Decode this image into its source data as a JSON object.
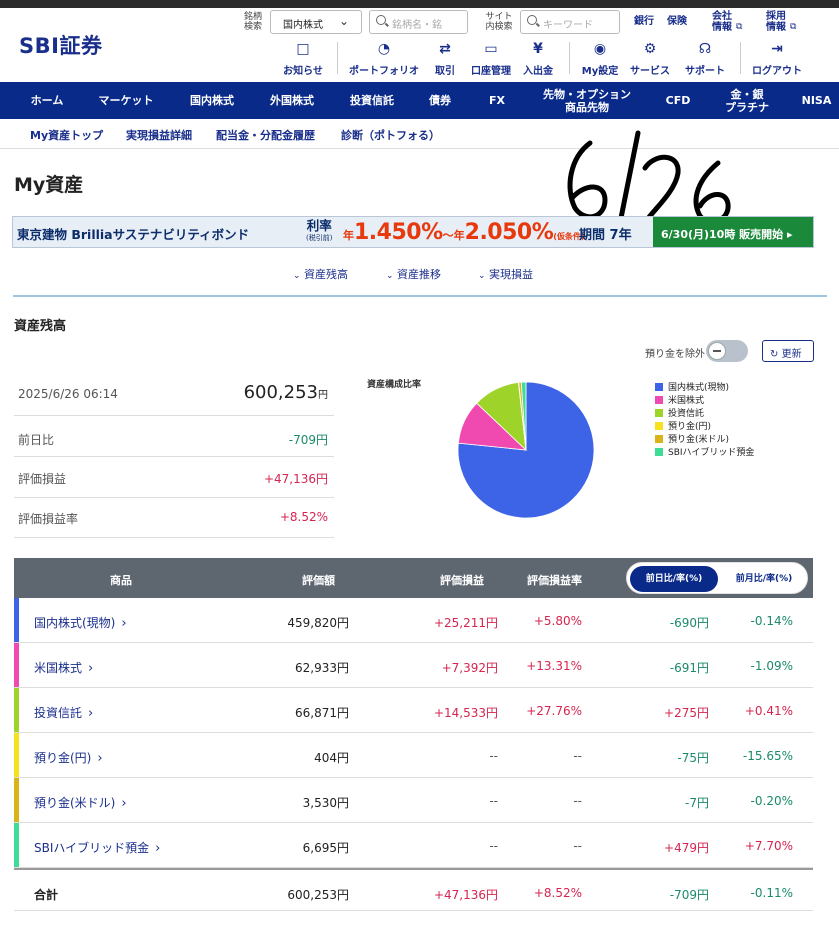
{
  "header": {
    "logo": "SBI証券",
    "stock_search": {
      "label": "銘柄\n検索",
      "select_value": "国内株式",
      "placeholder": "銘柄名・銘"
    },
    "site_search": {
      "label": "サイト\n内検索",
      "placeholder": "キーワード"
    },
    "links": [
      "銀行",
      "保険",
      "会社\n情報",
      "採用\n情報"
    ],
    "toolbar": [
      {
        "label": "お知らせ",
        "icon": "chat-icon"
      },
      {
        "label": "ポートフォリオ",
        "icon": "portfolio-icon"
      },
      {
        "label": "取引",
        "icon": "trade-icon"
      },
      {
        "label": "口座管理",
        "icon": "account-icon"
      },
      {
        "label": "入出金",
        "icon": "yen-icon"
      },
      {
        "label": "My設定",
        "icon": "user-icon"
      },
      {
        "label": "サービス",
        "icon": "service-icon"
      },
      {
        "label": "サポート",
        "icon": "headset-icon"
      },
      {
        "label": "ログアウト",
        "icon": "logout-icon"
      }
    ]
  },
  "main_nav": [
    "ホーム",
    "マーケット",
    "国内株式",
    "外国株式",
    "投資信託",
    "債券",
    "FX",
    "先物・オプション\n商品先物",
    "CFD",
    "金・銀\nプラチナ",
    "NISA"
  ],
  "sub_nav": [
    "My資産トップ",
    "実現損益詳細",
    "配当金・分配金履歴",
    "診断（ポトフォる）"
  ],
  "page_title": "My資産",
  "handwritten_note": "6/26",
  "banner": {
    "issuer": "東京建物 Brilliaサステナビリティボンド",
    "rate_label": "利率",
    "rate_sub": "(税引前)",
    "rate_prefix": "年",
    "rate_low": "1.450%",
    "rate_sep": "～年",
    "rate_high": "2.050%",
    "rate_note": "(仮条件)",
    "term": "期間 7年",
    "cta": "6/30(月)10時 販売開始 ▸"
  },
  "anchors": [
    "資産残高",
    "資産推移",
    "実現損益"
  ],
  "section_title": "資産残高",
  "toggle_label": "預り金を除外",
  "refresh_label": "更新",
  "summary": {
    "datetime": "2025/6/26 06:14",
    "total": "600,253",
    "total_unit": "円",
    "rows": [
      {
        "label": "前日比",
        "value": "-709円",
        "sign": "neg"
      },
      {
        "label": "評価損益",
        "value": "+47,136円",
        "sign": "pos"
      },
      {
        "label": "評価損益率",
        "value": "+8.52%",
        "sign": "pos"
      }
    ]
  },
  "chart_data": {
    "type": "pie",
    "title": "資産構成比率",
    "legend_position": "right",
    "slices": [
      {
        "label": "国内株式(現物)",
        "value": 459820,
        "color": "#3d63e6"
      },
      {
        "label": "米国株式",
        "value": 62933,
        "color": "#f04ab0"
      },
      {
        "label": "投資信託",
        "value": 66871,
        "color": "#9ed429"
      },
      {
        "label": "預り金(円)",
        "value": 404,
        "color": "#f5e21c"
      },
      {
        "label": "預り金(米ドル)",
        "value": 3530,
        "color": "#d9b418"
      },
      {
        "label": "SBIハイブリッド預金",
        "value": 6695,
        "color": "#3ddc97"
      }
    ]
  },
  "table": {
    "headers": [
      "商品",
      "評価額",
      "評価損益",
      "評価損益率"
    ],
    "tabs": [
      "前日比/率(%)",
      "前月比/率(%)"
    ],
    "rows": [
      {
        "name": "国内株式(現物)",
        "color": "#3d63e6",
        "value": "459,820円",
        "pl": "+25,211円",
        "pl_rate": "+5.80%",
        "day": "-690円",
        "day_rate": "-0.14%"
      },
      {
        "name": "米国株式",
        "color": "#f04ab0",
        "value": "62,933円",
        "pl": "+7,392円",
        "pl_rate": "+13.31%",
        "day": "-691円",
        "day_rate": "-1.09%"
      },
      {
        "name": "投資信託",
        "color": "#9ed429",
        "value": "66,871円",
        "pl": "+14,533円",
        "pl_rate": "+27.76%",
        "day": "+275円",
        "day_rate": "+0.41%"
      },
      {
        "name": "預り金(円)",
        "color": "#f5e21c",
        "value": "404円",
        "pl": "--",
        "pl_rate": "--",
        "day": "-75円",
        "day_rate": "-15.65%"
      },
      {
        "name": "預り金(米ドル)",
        "color": "#d9b418",
        "value": "3,530円",
        "pl": "--",
        "pl_rate": "--",
        "day": "-7円",
        "day_rate": "-0.20%"
      },
      {
        "name": "SBIハイブリッド預金",
        "color": "#3ddc97",
        "value": "6,695円",
        "pl": "--",
        "pl_rate": "--",
        "day": "+479円",
        "day_rate": "+7.70%"
      }
    ],
    "total": {
      "name": "合計",
      "value": "600,253円",
      "pl": "+47,136円",
      "pl_rate": "+8.52%",
      "day": "-709円",
      "day_rate": "-0.11%"
    }
  }
}
